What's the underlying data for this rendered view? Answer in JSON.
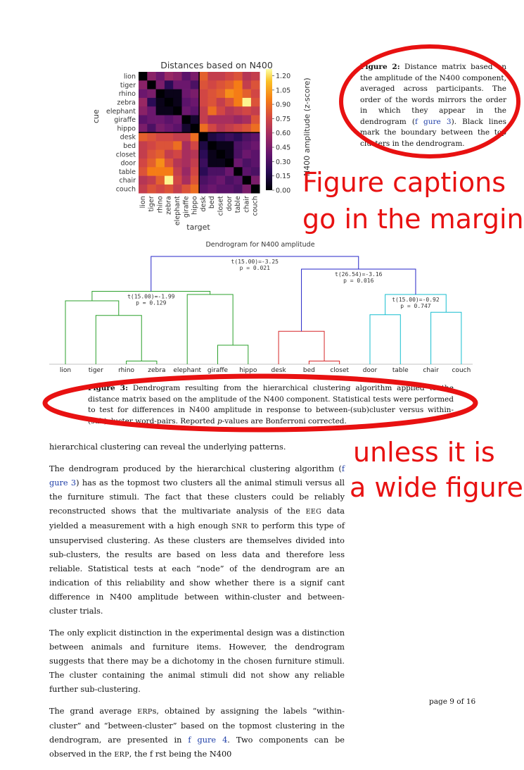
{
  "heatmap": {
    "title": "Distances based on N400 amplitude",
    "ylabel": "cue",
    "xlabel": "target",
    "colorbar_label": "N400 amplitude (z-score)",
    "colorbar_ticks": [
      "1.20",
      "1.05",
      "0.90",
      "0.75",
      "0.60",
      "0.45",
      "0.30",
      "0.15",
      "0.00"
    ]
  },
  "fig2_caption": {
    "label": "Figure 2:",
    "text_before": " Distance matrix based on the amplitude of the N400 component, averaged across participants. The order of the words mirrors the order in which they appear in the dendrogram (",
    "link": "f gure 3",
    "text_after": "). Black lines mark the boundary between the top clusters in the dendrogram."
  },
  "annotation_margin": [
    "Figure captions",
    "go in the margin"
  ],
  "dendrogram": {
    "title": "Dendrogram for N400 amplitude",
    "nodes": [
      {
        "stat": "t(15.00)=-3.25",
        "p": "p = 0.021"
      },
      {
        "stat": "t(26.54)=-3.16",
        "p": "p = 0.016"
      },
      {
        "stat": "t(15.00)=-1.99",
        "p": "p = 0.129"
      },
      {
        "stat": "t(15.00)=-0.92",
        "p": "p = 0.747"
      }
    ]
  },
  "fig3_caption": {
    "label": "Figure 3:",
    "text1": " Dendrogram resulting from the hierarchical clustering algorithm applied to the distance matrix based on the amplitude of the N400 component. Statistical tests were performed to test for differences in N400 amplitude in response to between-(sub)cluster versus within-(sub)cluster word-pairs. Reported ",
    "p_symbol": "p",
    "text2": "-values are Bonferroni corrected."
  },
  "annotation_wide": [
    "unless it is",
    "a wide figure"
  ],
  "body": {
    "p1": "hierarchical clustering can reveal the underlying patterns.",
    "p2_a": "The dendrogram produced by the hierarchical clustering algorithm (",
    "p2_link": "f gure 3",
    "p2_b": ") has as the topmost two clusters all the animal stimuli versus all the furniture stimuli. The fact that these clusters could be reliably reconstructed shows that the multivariate analysis of the ",
    "p2_eeg": "EEG",
    "p2_c": " data yielded a measurement with a high enough ",
    "p2_snr": "SNR",
    "p2_d": " to perform this type of unsupervised clustering. As these clusters are themselves divided into sub-clusters, the results are based on less data and therefore less reliable. Statistical tests at each “node” of the dendrogram are an indication of this reliability and show whether there is a signif cant difference in N400 amplitude between within-cluster and between-cluster trials.",
    "p3": "The only explicit distinction in the experimental design was a distinction between animals and furniture items. However, the dendrogram suggests that there may be a dichotomy in the chosen furniture stimuli. The cluster containing the animal stimuli did not show any reliable further sub-clustering.",
    "p4_a": "The grand average ",
    "p4_erps": "ERP",
    "p4_b": "s, obtained by assigning the labels “within-cluster” and “between-cluster” based on the topmost clustering in the dendrogram, are presented in ",
    "p4_link": "f gure 4",
    "p4_c": ". Two components can be observed in the ",
    "p4_erp": "ERP",
    "p4_d": ", the f rst being the N400"
  },
  "page_number": "page 9 of 16",
  "chart_data": [
    {
      "type": "heatmap",
      "title": "Distances based on N400 amplitude",
      "xlabel": "target",
      "ylabel": "cue",
      "rows": [
        "lion",
        "tiger",
        "rhino",
        "zebra",
        "elephant",
        "giraffe",
        "hippo",
        "desk",
        "bed",
        "closet",
        "door",
        "table",
        "chair",
        "couch"
      ],
      "cols": [
        "lion",
        "tiger",
        "rhino",
        "zebra",
        "elephant",
        "giraffe",
        "hippo",
        "desk",
        "bed",
        "closet",
        "door",
        "table",
        "chair",
        "couch"
      ],
      "colorbar": {
        "label": "N400 amplitude (z-score)",
        "range": [
          0.0,
          1.27
        ]
      },
      "values": [
        [
          0.0,
          0.5,
          0.4,
          0.55,
          0.5,
          0.35,
          0.45,
          0.85,
          0.7,
          0.7,
          0.75,
          0.8,
          0.65,
          0.7
        ],
        [
          0.5,
          0.0,
          0.45,
          0.2,
          0.4,
          0.4,
          0.3,
          0.8,
          0.75,
          0.8,
          0.85,
          0.95,
          0.7,
          0.8
        ],
        [
          0.4,
          0.45,
          0.0,
          0.05,
          0.05,
          0.4,
          0.45,
          0.75,
          0.8,
          0.85,
          1.0,
          0.95,
          0.85,
          0.75
        ],
        [
          0.55,
          0.2,
          0.05,
          0.0,
          0.05,
          0.35,
          0.4,
          0.75,
          0.8,
          0.7,
          0.8,
          0.95,
          1.25,
          0.8
        ],
        [
          0.5,
          0.4,
          0.05,
          0.05,
          0.0,
          0.4,
          0.35,
          0.7,
          0.9,
          0.75,
          0.65,
          0.7,
          0.75,
          0.7
        ],
        [
          0.35,
          0.4,
          0.4,
          0.35,
          0.4,
          0.0,
          0.1,
          0.7,
          0.6,
          0.6,
          0.6,
          0.55,
          0.6,
          0.8
        ],
        [
          0.45,
          0.3,
          0.45,
          0.4,
          0.35,
          0.1,
          0.0,
          0.9,
          0.75,
          0.65,
          0.7,
          0.75,
          0.8,
          0.9
        ],
        [
          0.85,
          0.8,
          0.75,
          0.75,
          0.7,
          0.7,
          0.9,
          0.0,
          0.15,
          0.2,
          0.25,
          0.2,
          0.3,
          0.35
        ],
        [
          0.7,
          0.75,
          0.8,
          0.8,
          0.9,
          0.6,
          0.75,
          0.15,
          0.0,
          0.05,
          0.05,
          0.3,
          0.35,
          0.4
        ],
        [
          0.7,
          0.8,
          0.85,
          0.7,
          0.75,
          0.6,
          0.65,
          0.2,
          0.05,
          0.0,
          0.05,
          0.3,
          0.4,
          0.35
        ],
        [
          0.75,
          0.85,
          1.0,
          0.8,
          0.65,
          0.6,
          0.7,
          0.25,
          0.05,
          0.05,
          0.0,
          0.4,
          0.3,
          0.35
        ],
        [
          0.8,
          0.95,
          0.95,
          0.95,
          0.7,
          0.55,
          0.75,
          0.2,
          0.3,
          0.3,
          0.4,
          0.0,
          0.35,
          0.3
        ],
        [
          0.65,
          0.7,
          0.85,
          1.25,
          0.75,
          0.6,
          0.8,
          0.3,
          0.35,
          0.4,
          0.3,
          0.35,
          0.0,
          0.45
        ],
        [
          0.7,
          0.8,
          0.75,
          0.8,
          0.7,
          0.8,
          0.9,
          0.35,
          0.4,
          0.35,
          0.35,
          0.3,
          0.45,
          0.0
        ]
      ]
    },
    {
      "type": "dendrogram",
      "title": "Dendrogram for N400 amplitude",
      "leaves": [
        "lion",
        "tiger",
        "rhino",
        "zebra",
        "elephant",
        "giraffe",
        "hippo",
        "desk",
        "bed",
        "closet",
        "door",
        "table",
        "chair",
        "couch"
      ],
      "links": [
        {
          "children": [
            "rhino",
            "zebra"
          ],
          "height": 0.05,
          "color": "#2ca02c"
        },
        {
          "children": [
            "tiger",
            "rhino+zebra"
          ],
          "height": 0.77,
          "color": "#2ca02c"
        },
        {
          "children": [
            "lion",
            "tiger+rhino+zebra"
          ],
          "height": 1.0,
          "color": "#2ca02c"
        },
        {
          "children": [
            "giraffe",
            "hippo"
          ],
          "height": 0.3,
          "color": "#2ca02c"
        },
        {
          "children": [
            "elephant",
            "giraffe+hippo"
          ],
          "height": 1.1,
          "color": "#2ca02c"
        },
        {
          "children": [
            "animals-left",
            "animals-right"
          ],
          "height": 1.15,
          "color": "#2ca02c"
        },
        {
          "children": [
            "bed",
            "closet"
          ],
          "height": 0.05,
          "color": "#d62728"
        },
        {
          "children": [
            "desk",
            "bed+closet"
          ],
          "height": 0.52,
          "color": "#d62728"
        },
        {
          "children": [
            "door",
            "table"
          ],
          "height": 0.78,
          "color": "#17becf"
        },
        {
          "children": [
            "chair",
            "couch"
          ],
          "height": 0.82,
          "color": "#17becf"
        },
        {
          "children": [
            "door+table",
            "chair+couch"
          ],
          "height": 1.1,
          "color": "#17becf"
        },
        {
          "children": [
            "desk-group",
            "door-group"
          ],
          "height": 1.5,
          "color": "#1f1fcf"
        },
        {
          "children": [
            "animals",
            "furniture"
          ],
          "height": 1.7,
          "color": "#1f1fcf"
        }
      ]
    }
  ]
}
